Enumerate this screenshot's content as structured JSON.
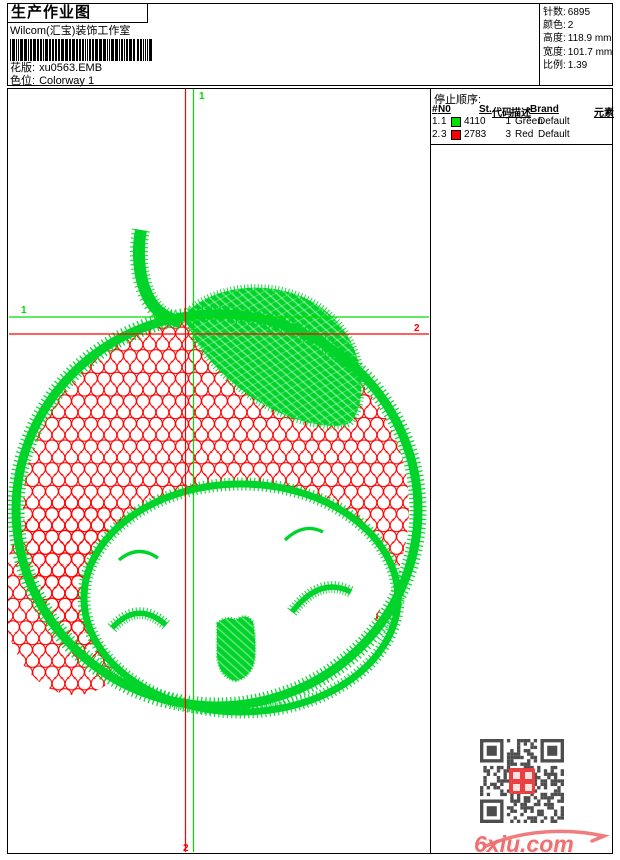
{
  "header": {
    "title": "生产作业图",
    "company": "Wilcom(汇宝)装饰工作室",
    "fields": [
      {
        "label": "花版:",
        "value": "xu0563.EMB"
      },
      {
        "label": "色位:",
        "value": "Colorway 1"
      }
    ],
    "info": [
      {
        "label": "针数:",
        "value": "6895"
      },
      {
        "label": "颜色:",
        "value": "2"
      },
      {
        "label": "高度:",
        "value": "118.9 mm"
      },
      {
        "label": "宽度:",
        "value": "101.7 mm"
      },
      {
        "label": "比例:",
        "value": "1.39"
      }
    ]
  },
  "stop_sequence": {
    "title": "停止顺序:",
    "columns": [
      "#",
      "N0",
      "St.",
      "代码",
      "描述",
      "Brand",
      "元素"
    ],
    "rows": [
      {
        "index": "1.",
        "needle": "1",
        "swatch": "#00e000",
        "stitches": "4110",
        "code": "1",
        "description": "Green",
        "brand": "Default",
        "element": ""
      },
      {
        "index": "2.",
        "needle": "3",
        "swatch": "#ff0000",
        "stitches": "2783",
        "code": "3",
        "description": "Red",
        "brand": "Default",
        "element": ""
      }
    ]
  },
  "guides": {
    "start_label": "1",
    "end_label": "2",
    "start_color": "#00dd00",
    "end_color": "#ff0000"
  },
  "design": {
    "subject": "apple-face-embroidery",
    "green": "#00d42a",
    "red": "#ff0000"
  },
  "watermark": {
    "text": "6xiu.com",
    "color": "#ee6f70"
  }
}
